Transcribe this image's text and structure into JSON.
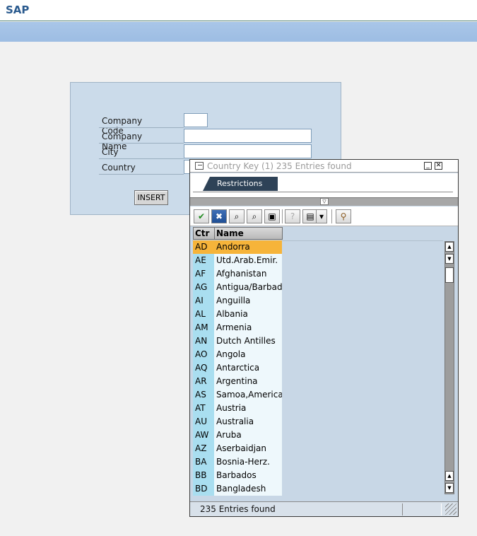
{
  "app": {
    "brand": "SAP"
  },
  "form": {
    "fields": [
      {
        "label": "Company Code",
        "value": ""
      },
      {
        "label": "Company Name",
        "value": ""
      },
      {
        "label": "City",
        "value": ""
      },
      {
        "label": "Country",
        "value": ""
      }
    ],
    "insert_label": "INSERT"
  },
  "popup": {
    "title": "Country Key (1)  235 Entries found",
    "tab_label": "Restrictions",
    "columns": [
      "Ctr",
      "Name"
    ],
    "rows": [
      {
        "code": "AD",
        "name": "Andorra"
      },
      {
        "code": "AE",
        "name": "Utd.Arab.Emir."
      },
      {
        "code": "AF",
        "name": "Afghanistan"
      },
      {
        "code": "AG",
        "name": "Antigua/Barbads"
      },
      {
        "code": "AI",
        "name": "Anguilla"
      },
      {
        "code": "AL",
        "name": "Albania"
      },
      {
        "code": "AM",
        "name": "Armenia"
      },
      {
        "code": "AN",
        "name": "Dutch Antilles"
      },
      {
        "code": "AO",
        "name": "Angola"
      },
      {
        "code": "AQ",
        "name": "Antarctica"
      },
      {
        "code": "AR",
        "name": "Argentina"
      },
      {
        "code": "AS",
        "name": "Samoa,American"
      },
      {
        "code": "AT",
        "name": "Austria"
      },
      {
        "code": "AU",
        "name": "Australia"
      },
      {
        "code": "AW",
        "name": "Aruba"
      },
      {
        "code": "AZ",
        "name": "Aserbaidjan"
      },
      {
        "code": "BA",
        "name": "Bosnia-Herz."
      },
      {
        "code": "BB",
        "name": "Barbados"
      },
      {
        "code": "BD",
        "name": "Bangladesh"
      }
    ],
    "status": "235 Entries found",
    "colors": {
      "selected": "#f6b43a",
      "code_bg": "#a9def0",
      "name_bg": "#eef8fc"
    }
  }
}
